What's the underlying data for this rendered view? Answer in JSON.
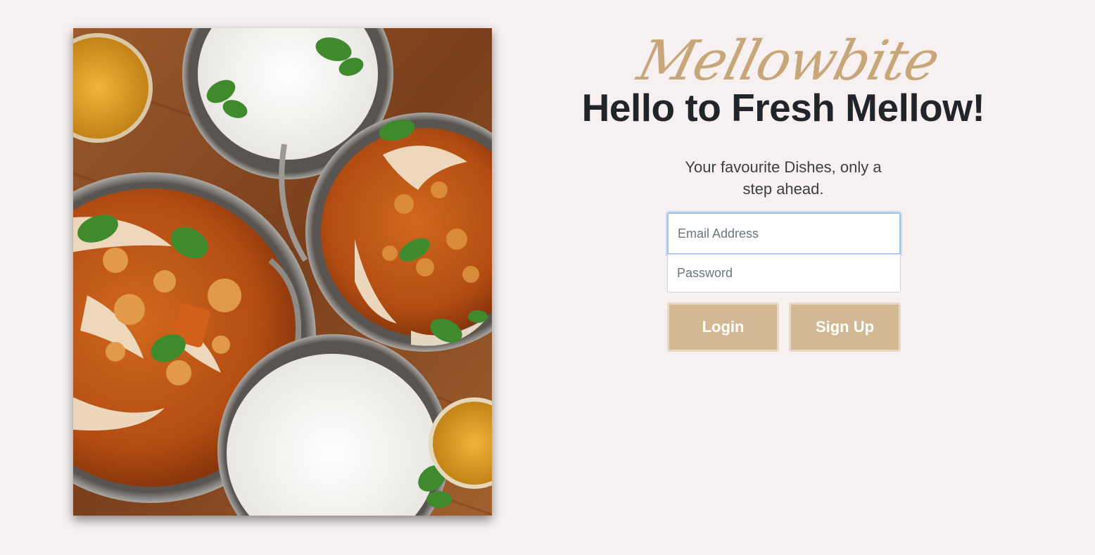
{
  "photo": {
    "alt": "Bowls of curry and rice on a wooden table"
  },
  "brand": {
    "name": "Mellowbite"
  },
  "hero": {
    "headline": "Hello to Fresh Mellow!",
    "tagline": "Your favourite Dishes, only a step ahead."
  },
  "form": {
    "email_placeholder": "Email Address",
    "password_placeholder": "Password",
    "email_value": "",
    "password_value": ""
  },
  "buttons": {
    "login_label": "Login",
    "signup_label": "Sign Up"
  },
  "colors": {
    "background": "#f6f0f0",
    "accent": "#d3b894",
    "brand_script": "#c5a474",
    "headline": "#212529",
    "focus_ring": "#9fc3ef"
  }
}
